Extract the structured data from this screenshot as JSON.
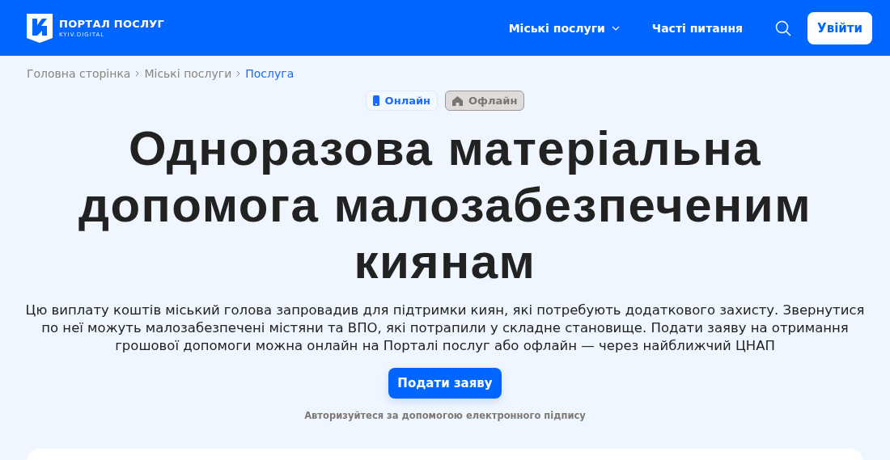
{
  "header": {
    "logo_title": "ПОРТАЛ ПОСЛУГ",
    "logo_subtitle": "KYIV.DIGITAL",
    "nav": [
      {
        "label": "Міські послуги",
        "kind": "dropdown"
      },
      {
        "label": "Часті питання",
        "kind": "link"
      }
    ],
    "login": "Увійти"
  },
  "breadcrumbs": [
    {
      "label": "Головна сторінка",
      "selected": false
    },
    {
      "label": "Міські послуги",
      "selected": false
    },
    {
      "label": "Послуга",
      "selected": true
    }
  ],
  "modes": [
    {
      "label": "Онлайн",
      "kind": "phone",
      "selected": false
    },
    {
      "label": "Офлайн",
      "kind": "home",
      "selected": true
    }
  ],
  "title": "Одноразова матеріальна допомога малозабезпеченим киянам",
  "description": "Цю виплату коштів міський голова запровадив для підтримки киян, які потребують додаткового захисту. Звернутися по неї можуть малозабезпечені містяни та ВПО, які потрапили у складне становище. Подати заяву на отримання грошової допомоги можна онлайн на Порталі послуг або офлайн — через найближчий ЦНАП",
  "apply_button": "Подати заяву",
  "apply_note": "Авторизуйтеся за допомогою електронного підпису"
}
